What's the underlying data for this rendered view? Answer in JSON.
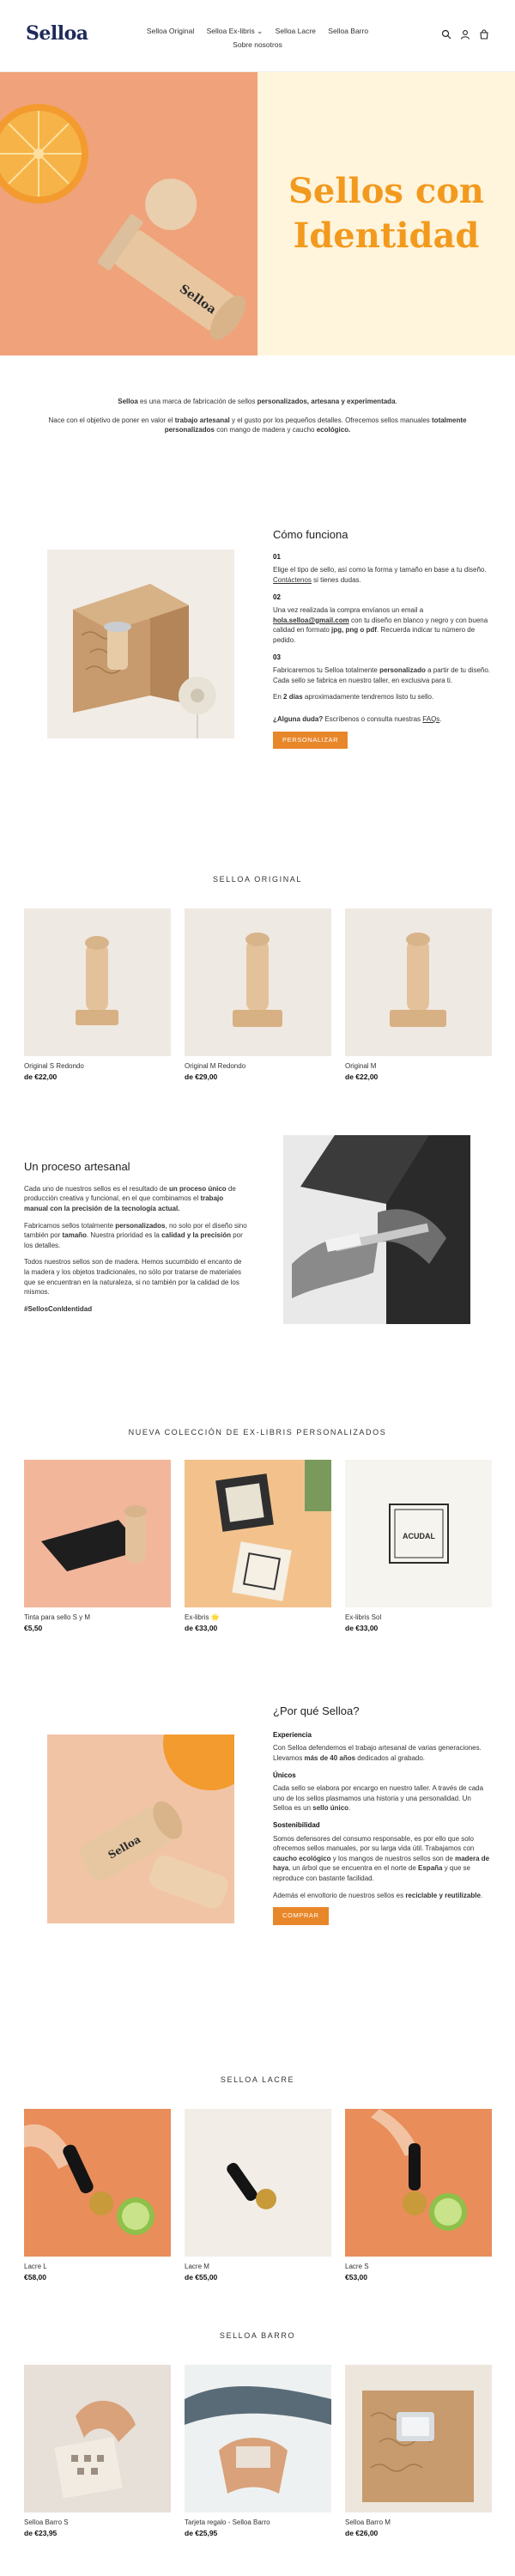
{
  "header": {
    "logo": "Selloa",
    "nav": [
      "Selloa Original",
      "Selloa Ex-libris ⌄",
      "Selloa Lacre",
      "Selloa Barro",
      "Sobre nosotros"
    ]
  },
  "hero": {
    "title_line1": "Sellos con",
    "title_line2": "Identidad"
  },
  "intro": {
    "p1_a": "Selloa",
    "p1_b": " es una marca de fabricación de sellos ",
    "p1_c": "personalizados, artesana y experimentada",
    "p1_d": ".",
    "p2_a": "Nace con el objetivo de poner en valor el ",
    "p2_b": "trabajo artesanal",
    "p2_c": " y el gusto por los pequeños detalles. Ofrecemos sellos manuales ",
    "p2_d": "totalmente personalizados",
    "p2_e": " con mango de madera y caucho ",
    "p2_f": "ecológico."
  },
  "how": {
    "title": "Cómo funciona",
    "step1_num": "01",
    "step1_a": "Elige el tipo de sello, así como la forma y tamaño en base a tu diseño. ",
    "step1_link": "Contáctenos",
    "step1_b": " si tienes dudas.",
    "step2_num": "02",
    "step2_a": "Una vez realizada la compra envíanos un email a ",
    "step2_email": "hola.selloa@gmail.com",
    "step2_b": " con tu diseño en blanco y negro y con buena calidad en formato ",
    "step2_fmt": "jpg, png o pdf",
    "step2_c": ". Recuerda indicar tu número de pedido.",
    "step3_num": "03",
    "step3_a": "Fabricaremos tu Selloa totalmente ",
    "step3_b": "personalizado",
    "step3_c": " a partir de tu diseño. Cada sello se fabrica en nuestro taller, en exclusiva para ti.",
    "step3_d_a": "En ",
    "step3_d_b": "2 días",
    "step3_d_c": " aproximadamente tendremos listo tu sello.",
    "faq_a": "¿Alguna duda?",
    "faq_b": " Escríbenos o consulta nuestras ",
    "faq_link": "FAQs",
    "faq_c": ".",
    "button": "Personalizar"
  },
  "original": {
    "title": "SELLOA ORIGINAL",
    "products": [
      {
        "name": "Original S Redondo",
        "price": "de €22,00"
      },
      {
        "name": "Original M Redondo",
        "price": "de €29,00"
      },
      {
        "name": "Original M",
        "price": "de €22,00"
      }
    ]
  },
  "process": {
    "title": "Un proceso artesanal",
    "p1_a": "Cada uno de nuestros sellos es el resultado de ",
    "p1_b": "un proceso único",
    "p1_c": " de producción creativa y funcional, en el que combinamos el ",
    "p1_d": "trabajo manual con la precisión de la tecnología actual.",
    "p2_a": "Fabricamos sellos totalmente ",
    "p2_b": "personalizados",
    "p2_c": ", no solo por el diseño sino también por ",
    "p2_d": "tamaño",
    "p2_e": ". Nuestra prioridad es la ",
    "p2_f": "calidad y la precisión",
    "p2_g": " por los detalles.",
    "p3": "Todos nuestros sellos son de madera. Hemos sucumbido el encanto de la madera y los objetos tradicionales, no sólo por tratarse de materiales que se encuentran en la naturaleza, si no también por la calidad de los mismos.",
    "hashtag": "#SellosConIdentidad"
  },
  "exlibris": {
    "title": "NUEVA COLECCIÓN DE EX-LIBRIS PERSONALIZADOS",
    "products": [
      {
        "name": "Tinta para sello S y M",
        "price": "€5,50"
      },
      {
        "name": "Ex-libris 🌟",
        "price": "de €33,00"
      },
      {
        "name": "Ex-libris Sol",
        "price": "de €33,00"
      }
    ],
    "stamp_text": "ACUDAL"
  },
  "why": {
    "title": "¿Por qué Selloa?",
    "sub1": "Experiencia",
    "p1_a": "Con Selloa defendemos el trabajo artesanal de varias generaciones. Llevamos ",
    "p1_b": "más de 40 años",
    "p1_c": " dedicados al grabado.",
    "sub2": "Únicos",
    "p2_a": "Cada sello se elabora por encargo en nuestro taller. A través de cada uno de los sellos plasmamos una historia y una personalidad. Un Selloa es un ",
    "p2_b": "sello único",
    "p2_c": ".",
    "sub3": "Sostenibilidad",
    "p3_a": "Somos defensores del consumo responsable, es por ello que solo ofrecemos sellos manuales, por su larga vida útil. Trabajamos con ",
    "p3_b": "caucho ecológico",
    "p3_c": " y los mangos de nuestros sellos son de ",
    "p3_d": "madera de haya",
    "p3_e": ", un árbol que se encuentra en el norte de ",
    "p3_f": "España",
    "p3_g": " y que se reproduce con bastante facilidad.",
    "p4_a": "Además el envoltorio de nuestros sellos es ",
    "p4_b": "reciclable y reutilizable",
    "p4_c": ".",
    "button": "Comprar"
  },
  "lacre": {
    "title": "SELLOA LACRE",
    "products": [
      {
        "name": "Lacre L",
        "price": "€58,00"
      },
      {
        "name": "Lacre M",
        "price": "de €55,00"
      },
      {
        "name": "Lacre S",
        "price": "€53,00"
      }
    ]
  },
  "barro": {
    "title": "SELLOA BARRO",
    "products": [
      {
        "name": "Selloa Barro S",
        "price": "de €23,95"
      },
      {
        "name": "Tarjeta regalo - Selloa Barro",
        "price": "de €25,95"
      },
      {
        "name": "Selloa Barro M",
        "price": "de €26,00"
      }
    ]
  },
  "colors": {
    "accent": "#e8872a",
    "hero_title": "#f29a1e",
    "logo": "#1e2a5a"
  },
  "icons": [
    "search-icon",
    "user-icon",
    "cart-icon"
  ]
}
